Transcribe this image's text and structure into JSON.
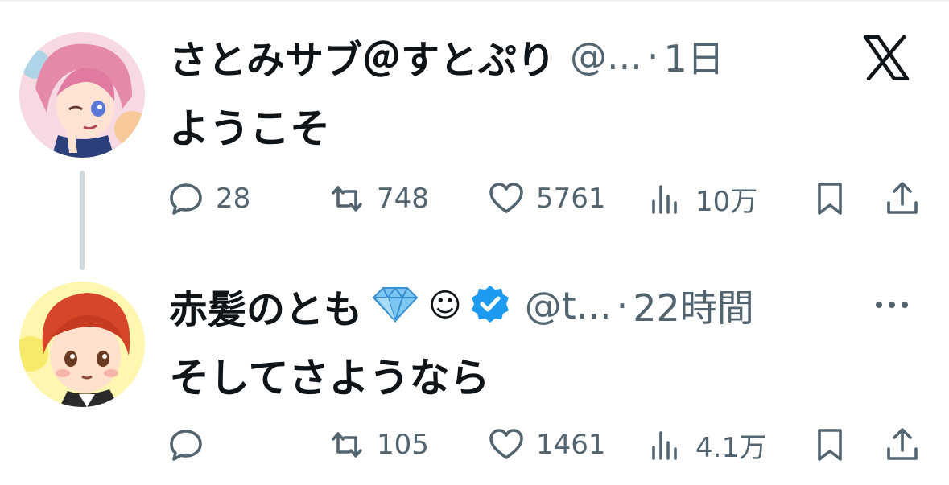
{
  "tweets": [
    {
      "name": "さとみサブ＠すとぷり",
      "handle": "@...",
      "separator": "·",
      "time": "1日",
      "text": "ようこそ",
      "replies": "28",
      "retweets": "748",
      "likes": "5761",
      "views": "10万",
      "avatar_icon": "pink-hair-anime-avatar",
      "platform_icon": "x-logo-icon"
    },
    {
      "name": "赤髪のとも",
      "handle": "@t...",
      "separator": "·",
      "time": "22時間",
      "text": "そしてさようなら",
      "replies": "",
      "retweets": "105",
      "likes": "1461",
      "views": "4.1万",
      "name_emoji": "☺",
      "avatar_icon": "red-hair-anime-avatar",
      "verified": true
    }
  ],
  "colors": {
    "text": "#0f1419",
    "secondary": "#536471",
    "verified_blue": "#1d9bf0",
    "thread_line": "#cfd9de"
  }
}
